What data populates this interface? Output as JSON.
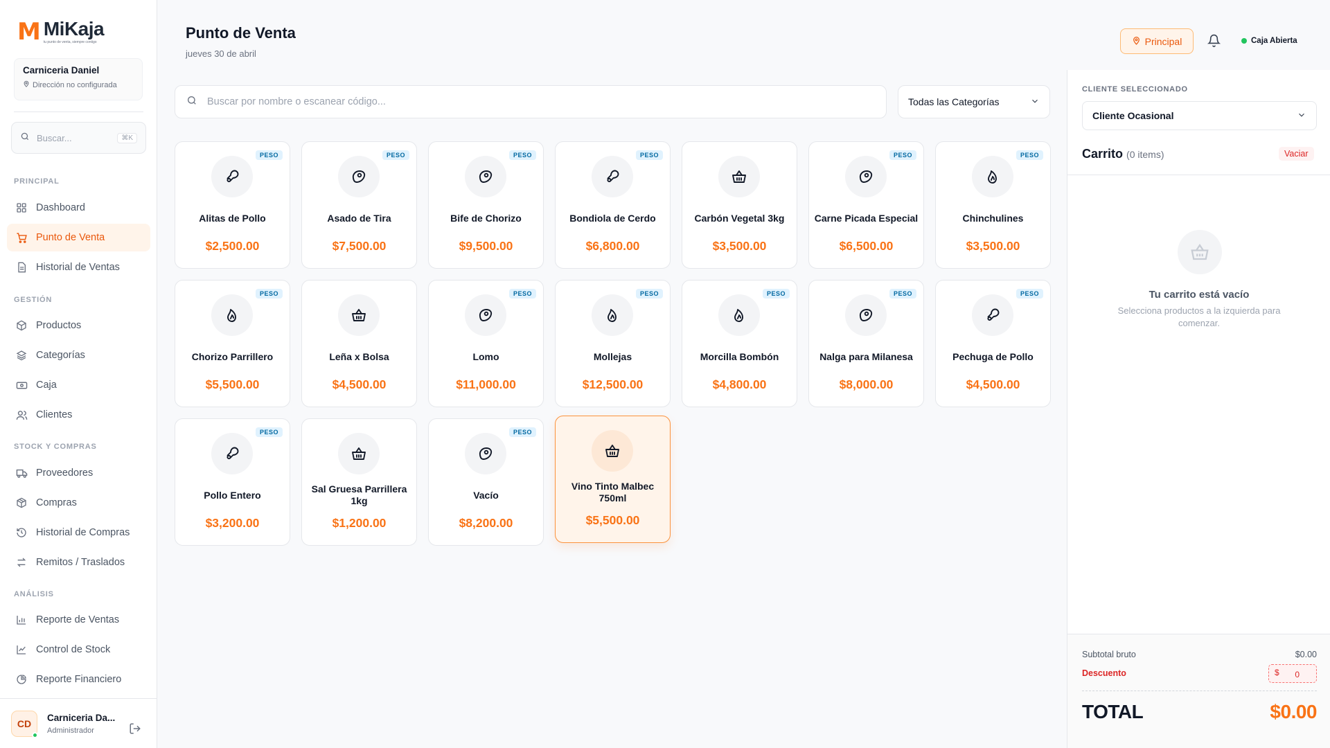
{
  "brand": {
    "name": "MiKaja",
    "tagline": "tu punto de venta, siempre contigo",
    "mark": "M"
  },
  "store": {
    "name": "Carniceria Daniel",
    "address": "Dirección no configurada"
  },
  "sidebar_search": {
    "placeholder": "Buscar...",
    "shortcut": "⌘K"
  },
  "sidebar": {
    "sections": [
      {
        "title": "PRINCIPAL"
      },
      {
        "title": "GESTIÓN"
      },
      {
        "title": "STOCK Y COMPRAS"
      },
      {
        "title": "ANÁLISIS"
      }
    ],
    "items": [
      {
        "label": "Dashboard",
        "icon": "grid-icon"
      },
      {
        "label": "Punto de Venta",
        "icon": "cart-icon",
        "active": true
      },
      {
        "label": "Historial de Ventas",
        "icon": "document-icon"
      },
      {
        "label": "Productos",
        "icon": "box-icon"
      },
      {
        "label": "Categorías",
        "icon": "layers-icon"
      },
      {
        "label": "Caja",
        "icon": "cash-icon"
      },
      {
        "label": "Clientes",
        "icon": "users-icon"
      },
      {
        "label": "Proveedores",
        "icon": "truck-icon"
      },
      {
        "label": "Compras",
        "icon": "package-icon"
      },
      {
        "label": "Historial de Compras",
        "icon": "history-icon"
      },
      {
        "label": "Remitos / Traslados",
        "icon": "transfer-icon"
      },
      {
        "label": "Reporte de Ventas",
        "icon": "bar-chart-icon"
      },
      {
        "label": "Control de Stock",
        "icon": "line-chart-icon"
      },
      {
        "label": "Reporte Financiero",
        "icon": "pie-chart-icon"
      }
    ]
  },
  "user": {
    "initials": "CD",
    "name": "Carniceria Da...",
    "role": "Administrador"
  },
  "header": {
    "title": "Punto de Venta",
    "date": "jueves 30 de abril",
    "branch": "Principal",
    "caja_status": "Caja Abierta"
  },
  "search": {
    "placeholder": "Buscar por nombre o escanear código..."
  },
  "category_filter": {
    "selected": "Todas las Categorías"
  },
  "products": [
    {
      "name": "Alitas de Pollo",
      "price": "$2,500.00",
      "badge": "PESO",
      "icon": "drumstick-icon"
    },
    {
      "name": "Asado de Tira",
      "price": "$7,500.00",
      "badge": "PESO",
      "icon": "steak-icon"
    },
    {
      "name": "Bife de Chorizo",
      "price": "$9,500.00",
      "badge": "PESO",
      "icon": "steak-icon"
    },
    {
      "name": "Bondiola de Cerdo",
      "price": "$6,800.00",
      "badge": "PESO",
      "icon": "drumstick-icon"
    },
    {
      "name": "Carbón Vegetal 3kg",
      "price": "$3,500.00",
      "badge": "",
      "icon": "basket-icon"
    },
    {
      "name": "Carne Picada Especial",
      "price": "$6,500.00",
      "badge": "PESO",
      "icon": "steak-icon"
    },
    {
      "name": "Chinchulines",
      "price": "$3,500.00",
      "badge": "PESO",
      "icon": "flame-icon"
    },
    {
      "name": "Chorizo Parrillero",
      "price": "$5,500.00",
      "badge": "PESO",
      "icon": "flame-icon"
    },
    {
      "name": "Leña x Bolsa",
      "price": "$4,500.00",
      "badge": "",
      "icon": "basket-icon"
    },
    {
      "name": "Lomo",
      "price": "$11,000.00",
      "badge": "PESO",
      "icon": "steak-icon"
    },
    {
      "name": "Mollejas",
      "price": "$12,500.00",
      "badge": "PESO",
      "icon": "flame-icon"
    },
    {
      "name": "Morcilla Bombón",
      "price": "$4,800.00",
      "badge": "PESO",
      "icon": "flame-icon"
    },
    {
      "name": "Nalga para Milanesa",
      "price": "$8,000.00",
      "badge": "PESO",
      "icon": "steak-icon"
    },
    {
      "name": "Pechuga de Pollo",
      "price": "$4,500.00",
      "badge": "PESO",
      "icon": "drumstick-icon"
    },
    {
      "name": "Pollo Entero",
      "price": "$3,200.00",
      "badge": "PESO",
      "icon": "drumstick-icon"
    },
    {
      "name": "Sal Gruesa Parrillera 1kg",
      "price": "$1,200.00",
      "badge": "",
      "icon": "basket-icon"
    },
    {
      "name": "Vacío",
      "price": "$8,200.00",
      "badge": "PESO",
      "icon": "steak-icon"
    },
    {
      "name": "Vino Tinto Malbec 750ml",
      "price": "$5,500.00",
      "badge": "",
      "icon": "basket-icon",
      "selected": true
    }
  ],
  "cart": {
    "client_label": "CLIENTE SELECCIONADO",
    "client": "Cliente Ocasional",
    "title": "Carrito",
    "count": "(0 items)",
    "clear": "Vaciar",
    "empty_title": "Tu carrito está vacío",
    "empty_sub": "Selecciona productos a la izquierda para comenzar.",
    "subtotal_label": "Subtotal bruto",
    "subtotal": "$0.00",
    "discount_label": "Descuento",
    "discount_currency": "$",
    "discount_value": "0",
    "total_label": "TOTAL",
    "total": "$0.00"
  },
  "colors": {
    "accent": "#f97316",
    "accent_bg": "#fff4ea",
    "badge_bg": "#e0f2fe",
    "badge_text": "#0369a1",
    "danger": "#dc2626",
    "success": "#22c55e"
  }
}
